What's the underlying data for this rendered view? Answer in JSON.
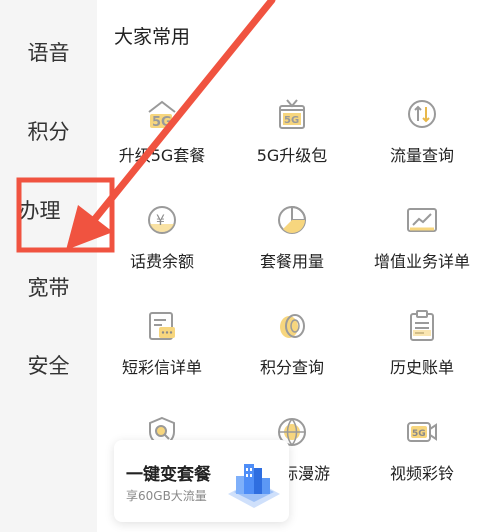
{
  "sidebar": {
    "items": [
      {
        "label": "语音"
      },
      {
        "label": "积分"
      },
      {
        "label": "办理"
      },
      {
        "label": "宽带"
      },
      {
        "label": "安全"
      }
    ]
  },
  "main": {
    "section_title": "大家常用",
    "tiles": [
      {
        "label": "升级5G套餐",
        "icon": "5g-upgrade-icon"
      },
      {
        "label": "5G升级包",
        "icon": "gift-5g-icon"
      },
      {
        "label": "流量查询",
        "icon": "data-usage-icon"
      },
      {
        "label": "话费余额",
        "icon": "yuan-balance-icon"
      },
      {
        "label": "套餐用量",
        "icon": "pie-chart-icon"
      },
      {
        "label": "增值业务详单",
        "icon": "trend-chart-icon"
      },
      {
        "label": "短彩信详单",
        "icon": "message-icon"
      },
      {
        "label": "积分查询",
        "icon": "points-coin-icon"
      },
      {
        "label": "历史账单",
        "icon": "clipboard-bill-icon"
      },
      {
        "label": "",
        "icon": "shield-search-icon"
      },
      {
        "label": "际漫游",
        "icon": "roaming-globe-icon"
      },
      {
        "label": "视频彩铃",
        "icon": "video-ringtone-icon"
      }
    ],
    "promo": {
      "title": "一键变套餐",
      "subtitle": "享60GB大流量"
    }
  },
  "colors": {
    "accent_red": "#f05340",
    "icon_gray": "#9a9a9a",
    "icon_yellow": "#f7d67e",
    "promo_blue": "#4f8ef7"
  }
}
